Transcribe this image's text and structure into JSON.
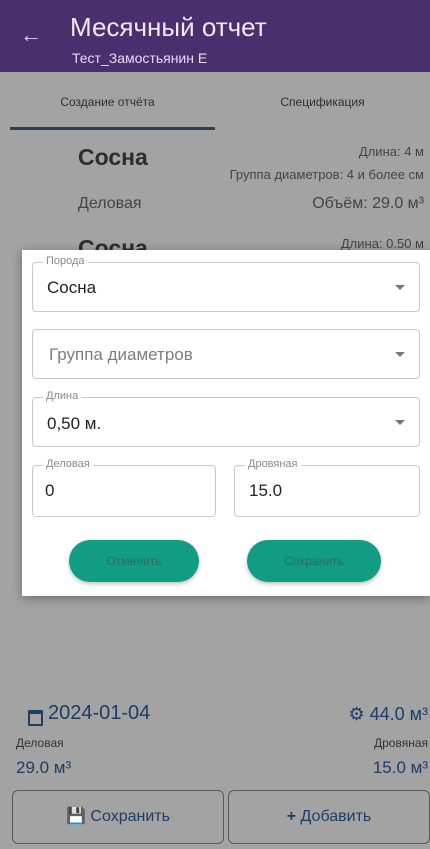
{
  "appbar": {
    "title": "Месячный отчет",
    "subtitle": "Тест_Замостьянин Е"
  },
  "tabs": [
    {
      "label": "Создание отчёта",
      "active": true
    },
    {
      "label": "Спецификация",
      "active": false
    }
  ],
  "cards": [
    {
      "name": "Сосна",
      "length": "Длина: 4 м",
      "group": "Группа диаметров: 4 и более см",
      "kind": "Деловая",
      "volume": "Объём: 29.0 м³"
    },
    {
      "name": "Сосна",
      "length": "Длина: 0.50 м"
    }
  ],
  "dialog": {
    "breed": {
      "label": "Порода",
      "value": "Сосна"
    },
    "diameter_group": {
      "placeholder": "Группа диаметров"
    },
    "length": {
      "label": "Длина",
      "value": "0,50 м."
    },
    "business": {
      "label": "Деловая",
      "value": "0"
    },
    "firewood": {
      "label": "Дровяная",
      "value": "15.0"
    },
    "cancel_label": "Отменить",
    "save_label": "Сохранить"
  },
  "summary": {
    "date": "2024-01-04",
    "total": "44.0 м³",
    "business_label": "Деловая",
    "business_value": "29.0 м³",
    "firewood_label": "Дровяная",
    "firewood_value": "15.0 м³"
  },
  "actions": {
    "save_label": "Сохранить",
    "add_label": "Добавить"
  },
  "colors": {
    "appbar": "#4a2f6e",
    "accent": "#119d84",
    "scrim": "#a3a3a3",
    "text_blue": "#1d3d66"
  },
  "icons": [
    "back-arrow-icon",
    "dropdown-arrow-icon",
    "calendar-icon",
    "total-icon",
    "save-icon",
    "plus-icon"
  ]
}
